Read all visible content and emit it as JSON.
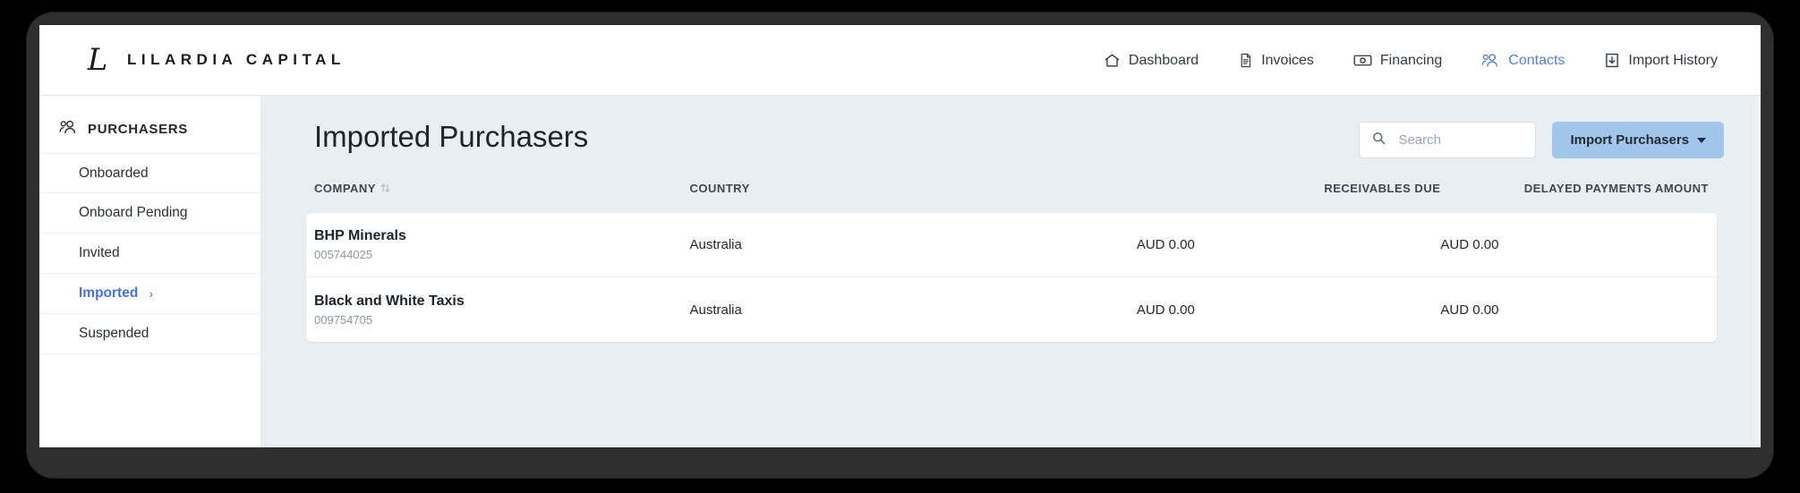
{
  "brand": {
    "monogram": "L",
    "name": "LILARDIA CAPITAL"
  },
  "topnav": {
    "items": [
      {
        "label": "Dashboard",
        "icon": "home-icon",
        "active": false
      },
      {
        "label": "Invoices",
        "icon": "document-icon",
        "active": false
      },
      {
        "label": "Financing",
        "icon": "banknote-icon",
        "active": false
      },
      {
        "label": "Contacts",
        "icon": "people-icon",
        "active": true
      },
      {
        "label": "Import History",
        "icon": "download-box-icon",
        "active": false
      }
    ]
  },
  "sidebar": {
    "heading": "PURCHASERS",
    "heading_icon": "people-icon",
    "items": [
      {
        "label": "Onboarded",
        "active": false
      },
      {
        "label": "Onboard Pending",
        "active": false
      },
      {
        "label": "Invited",
        "active": false
      },
      {
        "label": "Imported",
        "active": true,
        "chevron": "›"
      },
      {
        "label": "Suspended",
        "active": false
      }
    ]
  },
  "main": {
    "title": "Imported Purchasers",
    "search": {
      "value": "",
      "placeholder": "Search",
      "icon": "search-icon"
    },
    "import_button": {
      "label": "Import Purchasers",
      "icon": "caret-down-icon"
    }
  },
  "table": {
    "columns": [
      {
        "label": "COMPANY",
        "sortable": true,
        "sort_icon": "sort-updown-icon"
      },
      {
        "label": "COUNTRY",
        "sortable": false
      },
      {
        "label": "RECEIVABLES DUE",
        "sortable": false
      },
      {
        "label": "DELAYED PAYMENTS AMOUNT",
        "sortable": false
      }
    ],
    "rows": [
      {
        "company": "BHP Minerals",
        "id": "005744025",
        "country": "Australia",
        "receivables_due": "AUD 0.00",
        "delayed_payments_amount": "AUD 0.00"
      },
      {
        "company": "Black and White Taxis",
        "id": "009754705",
        "country": "Australia",
        "receivables_due": "AUD 0.00",
        "delayed_payments_amount": "AUD 0.00"
      }
    ]
  },
  "colors": {
    "accent_blue": "#5a7fd6",
    "sidebar_active": "#4a72d6",
    "button_blue": "#a2c6eb",
    "page_bg": "#e9eef2"
  }
}
